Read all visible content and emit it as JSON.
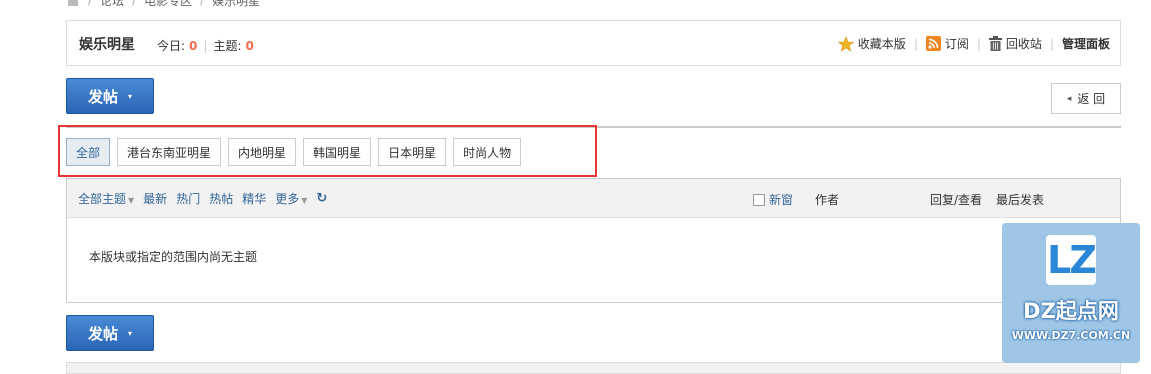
{
  "breadcrumb": {
    "items": [
      "论坛",
      "电影专区",
      "娱乐明星"
    ],
    "separator": "/"
  },
  "forum": {
    "name": "娱乐明星",
    "today_label": "今日:",
    "today_count": "0",
    "topics_label": "主题:",
    "topics_count": "0"
  },
  "header_actions": {
    "favorite": "收藏本版",
    "subscribe": "订阅",
    "recycle": "回收站",
    "admin": "管理面板"
  },
  "post_button": {
    "label": "发帖",
    "caret": "▾"
  },
  "back_button": {
    "label": "返 回",
    "arrow": "◂"
  },
  "tabs": [
    {
      "label": "全部",
      "active": true
    },
    {
      "label": "港台东南亚明星",
      "active": false
    },
    {
      "label": "内地明星",
      "active": false
    },
    {
      "label": "韩国明星",
      "active": false
    },
    {
      "label": "日本明星",
      "active": false
    },
    {
      "label": "时尚人物",
      "active": false
    }
  ],
  "thread_list": {
    "filters": {
      "all": "全部主题",
      "latest": "最新",
      "hot": "热门",
      "hot_posts": "热帖",
      "digest": "精华",
      "more": "更多"
    },
    "new_window": "新窗",
    "author": "作者",
    "replies_views": "回复/查看",
    "last_post": "最后发表",
    "empty": "本版块或指定的范围内尚无主题"
  },
  "watermark": {
    "logo": "LZ",
    "title": "DZ起点网",
    "url": "WWW.DZ7.COM.CN",
    "overlay_text": "返 回"
  },
  "colors": {
    "accent": "#2a66b6",
    "count": "#f26c4f",
    "link": "#336699",
    "highlight": "#e53535"
  }
}
